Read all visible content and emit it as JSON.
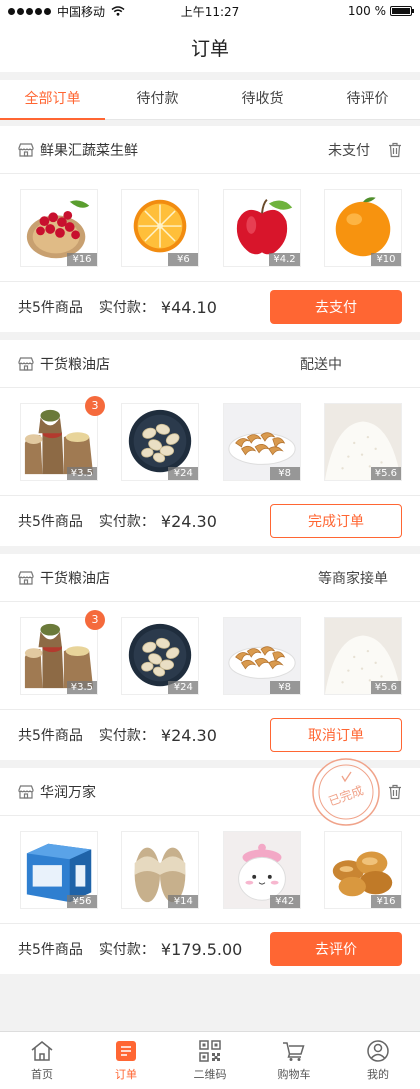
{
  "status_bar": {
    "carrier": "中国移动",
    "time": "上午11:27",
    "battery": "100 %"
  },
  "nav": {
    "title": "订单"
  },
  "tabs": [
    {
      "label": "全部订单",
      "active": true
    },
    {
      "label": "待付款",
      "active": false
    },
    {
      "label": "待收货",
      "active": false
    },
    {
      "label": "待评价",
      "active": false
    }
  ],
  "orders": [
    {
      "shop": "鲜果汇蔬菜生鲜",
      "status": "未支付",
      "products": [
        {
          "price": "¥16",
          "icon": "cherries"
        },
        {
          "price": "¥6",
          "icon": "orange-slice"
        },
        {
          "price": "¥4.2",
          "icon": "apple"
        },
        {
          "price": "¥10",
          "icon": "orange"
        }
      ],
      "count": "共5件商品",
      "paid_label": "实付款：",
      "amount": "¥44.10",
      "action": "去支付"
    },
    {
      "shop": "干货粮油店",
      "status": "配送中",
      "badge": "3",
      "products": [
        {
          "price": "¥3.5",
          "icon": "grain-sacks"
        },
        {
          "price": "¥24",
          "icon": "pistachios"
        },
        {
          "price": "¥8",
          "icon": "cashews"
        },
        {
          "price": "¥5.6",
          "icon": "rice"
        }
      ],
      "count": "共5件商品",
      "paid_label": "实付款：",
      "amount": "¥24.30",
      "action": "完成订单"
    },
    {
      "shop": "干货粮油店",
      "status": "等商家接单",
      "badge": "3",
      "products": [
        {
          "price": "¥3.5",
          "icon": "grain-sacks"
        },
        {
          "price": "¥24",
          "icon": "pistachios"
        },
        {
          "price": "¥8",
          "icon": "cashews"
        },
        {
          "price": "¥5.6",
          "icon": "rice"
        }
      ],
      "count": "共5件商品",
      "paid_label": "实付款：",
      "amount": "¥24.30",
      "action": "取消订单"
    },
    {
      "shop": "华润万家",
      "stamp": "已完成",
      "products": [
        {
          "price": "¥56",
          "icon": "purifier-box"
        },
        {
          "price": "¥14",
          "icon": "slippers"
        },
        {
          "price": "¥42",
          "icon": "cute-jar"
        },
        {
          "price": "¥16",
          "icon": "bread"
        }
      ],
      "count": "共5件商品",
      "paid_label": "实付款：",
      "amount": "¥179.5.00",
      "action": "去评价"
    }
  ],
  "tabbar": [
    {
      "label": "首页",
      "icon": "home-icon"
    },
    {
      "label": "订单",
      "icon": "order-icon",
      "active": true
    },
    {
      "label": "二维码",
      "icon": "qrcode-icon"
    },
    {
      "label": "购物车",
      "icon": "cart-icon"
    },
    {
      "label": "我的",
      "icon": "user-icon"
    }
  ],
  "colors": {
    "accent": "#ff6633",
    "badge": "#f56a3c",
    "background": "#f2f2f2"
  }
}
